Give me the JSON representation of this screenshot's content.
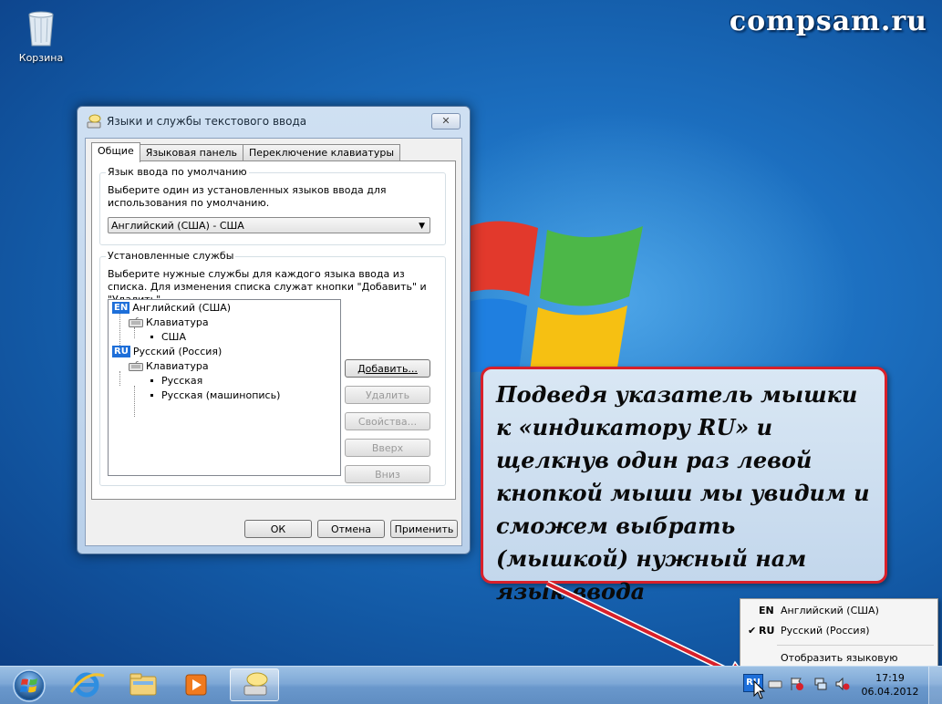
{
  "desktop": {
    "watermark": "compsam.ru",
    "recycle_bin_label": "Корзина"
  },
  "dialog": {
    "title": "Языки и службы текстового ввода",
    "close_label": "✕",
    "tabs": [
      "Общие",
      "Языковая панель",
      "Переключение клавиатуры"
    ],
    "default_group": {
      "legend": "Язык ввода по умолчанию",
      "description": "Выберите один из установленных языков ввода для использования по умолчанию.",
      "selected": "Английский (США) - США"
    },
    "services_group": {
      "legend": "Установленные службы",
      "description": "Выберите нужные службы для каждого языка ввода из списка. Для изменения списка служат кнопки \"Добавить\" и \"Удалить\".",
      "tree": {
        "en_badge": "EN",
        "en_lang": "Английский (США)",
        "en_keyboard": "Клавиатура",
        "en_layout": "США",
        "ru_badge": "RU",
        "ru_lang": "Русский (Россия)",
        "ru_keyboard": "Клавиатура",
        "ru_layout_1": "Русская",
        "ru_layout_2": "Русская (машинопись)"
      },
      "buttons": {
        "add": "Добавить...",
        "remove": "Удалить",
        "properties": "Свойства...",
        "up": "Вверх",
        "down": "Вниз"
      }
    },
    "footer": {
      "ok": "ОК",
      "cancel": "Отмена",
      "apply": "Применить"
    }
  },
  "callout": {
    "text": "Подведя указатель мышки к «индикатору RU» и щелкнув один раз левой кнопкой мыши мы увидим и сможем выбрать (мышкой) нужный нам язык ввода"
  },
  "language_menu": {
    "items": [
      {
        "code": "EN",
        "name": "Английский (США)",
        "checked": false
      },
      {
        "code": "RU",
        "name": "Русский (Россия)",
        "checked": true
      }
    ],
    "check_mark": "✔",
    "show_bar": "Отобразить языковую панель"
  },
  "taskbar": {
    "tray_lang": "RU",
    "time": "17:19",
    "date": "06.04.2012"
  },
  "colors": {
    "callout_border": "#d8202a",
    "lang_badge": "#1e6fd9"
  }
}
